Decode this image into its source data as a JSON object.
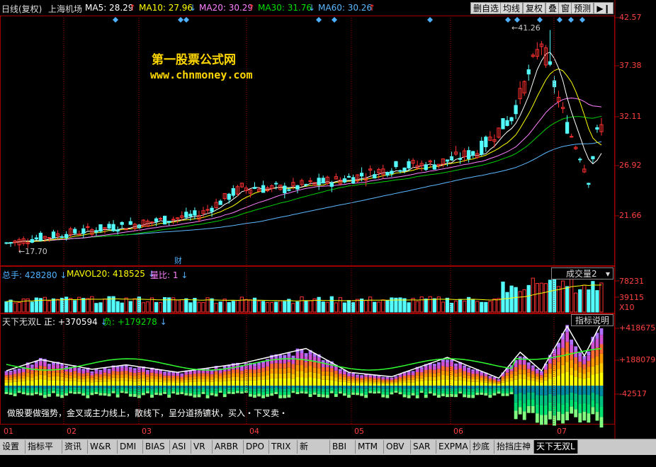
{
  "header": {
    "period": "日线(复权)",
    "stock": "上海机场",
    "ma5": "MA5: 28.29",
    "ma10": "MA10: 27.96",
    "ma20": "MA20: 30.29",
    "ma30": "MA30: 31.76",
    "ma60": "MA60: 30.26",
    "buttons": [
      "删自选",
      "均线",
      "复权",
      "叠",
      "窗",
      "预测"
    ]
  },
  "watermark": {
    "line1": "第一股票公式网",
    "line2": "www.chnmoney.com"
  },
  "price_axis": [
    "42.57",
    "37.38",
    "32.11",
    "26.92",
    "21.66"
  ],
  "price_labels": {
    "high": "41.26",
    "low": "17.70",
    "fin": "财"
  },
  "volume": {
    "total": "总手: 428280",
    "mavol": "MAVOL20: 418525",
    "ratio": "量比: 1",
    "selector": "成交量2",
    "axis": [
      "78231",
      "39115",
      "X10"
    ]
  },
  "indicator": {
    "name": "天下无双L",
    "pos": "正: +370594",
    "neg": "负: +179278",
    "button": "指标说明",
    "axis": [
      "+418675",
      "+188079",
      "-42517"
    ],
    "note": "做股要做强势，金叉或主力线上，散线下，呈分道扬镳状，买入・下叉卖・"
  },
  "months": [
    "01",
    "02",
    "03",
    "04",
    "05",
    "06",
    "07"
  ],
  "tabs": [
    "设置",
    "指标平台",
    "资讯",
    "W&R",
    "DMI",
    "BIAS",
    "ASI",
    "VR",
    "ARBR",
    "DPO",
    "TRIX",
    "新DMA",
    "BBI",
    "MTM",
    "OBV",
    "SAR",
    "EXPMA",
    "抄底",
    "抬挡庄神",
    "天下无双L"
  ],
  "colors": {
    "up": "#ff3030",
    "down": "#54ffff",
    "ma5": "#ffffff",
    "ma10": "#ffff00",
    "ma20": "#ff80ff",
    "ma30": "#00d000",
    "ma60": "#5cb8ff"
  },
  "chart_data": {
    "type": "candlestick",
    "x": [
      "01",
      "02",
      "03",
      "04",
      "05",
      "06",
      "07"
    ],
    "close_approx": [
      18.6,
      20.1,
      21.4,
      24.8,
      27.0,
      33.5,
      31.0
    ],
    "high": 41.26,
    "low": 17.7,
    "ylim": [
      17.5,
      42.57
    ]
  }
}
